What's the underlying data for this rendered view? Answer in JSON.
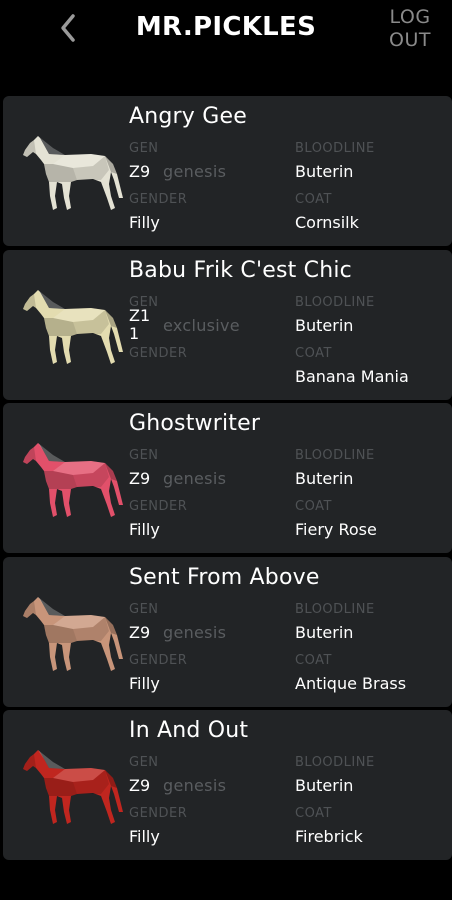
{
  "header": {
    "title": "MR.PICKLES",
    "logout_line1": "LOG",
    "logout_line2": "OUT",
    "back_icon": "chevron-left-icon"
  },
  "labels": {
    "gen": "GEN",
    "bloodline": "BLOODLINE",
    "gender": "GENDER",
    "coat": "COAT"
  },
  "horses": [
    {
      "name": "Angry Gee",
      "gen": "Z9",
      "type": "genesis",
      "bloodline": "Buterin",
      "gender": "Filly",
      "coat": "Cornsilk",
      "color": "#e4e2d4"
    },
    {
      "name": "Babu Frik C'est Chic",
      "gen": "Z11",
      "type": "exclusive",
      "bloodline": "Buterin",
      "gender": "",
      "coat": "Banana Mania",
      "color": "#e3dcb0"
    },
    {
      "name": "Ghostwriter",
      "gen": "Z9",
      "type": "genesis",
      "bloodline": "Buterin",
      "gender": "Filly",
      "coat": "Fiery Rose",
      "color": "#e2506a"
    },
    {
      "name": "Sent From Above",
      "gen": "Z9",
      "type": "genesis",
      "bloodline": "Buterin",
      "gender": "Filly",
      "coat": "Antique Brass",
      "color": "#c8957a"
    },
    {
      "name": "In And Out",
      "gen": "Z9",
      "type": "genesis",
      "bloodline": "Buterin",
      "gender": "Filly",
      "coat": "Firebrick",
      "color": "#c0261f"
    }
  ]
}
